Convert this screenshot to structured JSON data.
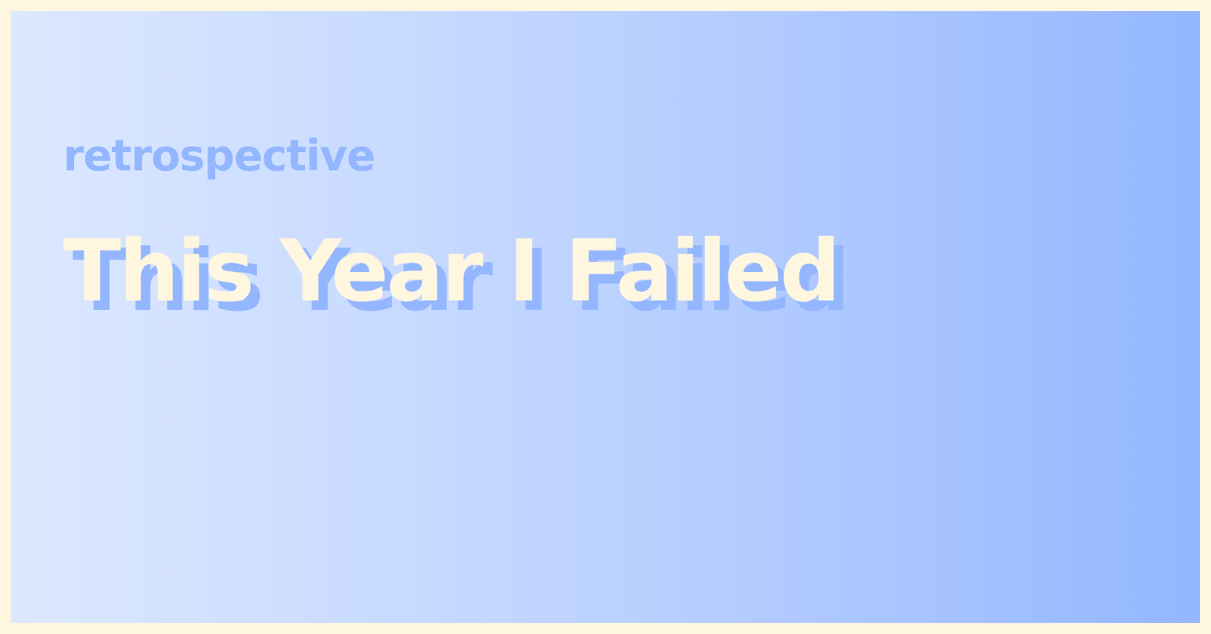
{
  "post": {
    "category": "retrospective",
    "title": "This Year I Failed"
  },
  "colors": {
    "frame": "#fff6e0",
    "gradient_start": "#dce8ff",
    "gradient_end": "#93b6ff",
    "category_text": "#93b6ff",
    "title_text": "#fff6e0",
    "title_shadow": "#93b6ff"
  }
}
